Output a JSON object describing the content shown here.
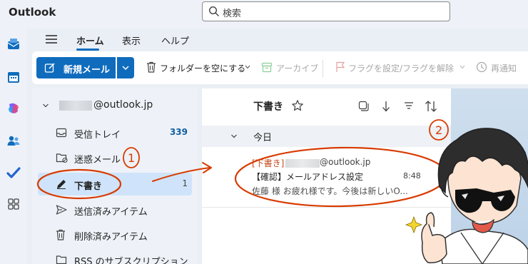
{
  "app": {
    "title": "Outlook"
  },
  "search": {
    "placeholder": "検索"
  },
  "ribbon": {
    "tabs": [
      "ホーム",
      "表示",
      "ヘルプ"
    ],
    "active_tab": "ホーム"
  },
  "toolbar": {
    "new_mail": "新規メール",
    "empty_folder": "フォルダーを空にする",
    "archive": "アーカイブ",
    "flag": "フラグを設定/フラグを解除",
    "snooze": "再通知"
  },
  "account": {
    "label": "@outlook.jp"
  },
  "folders": [
    {
      "name": "受信トレイ",
      "count": "339",
      "icon": "inbox-icon"
    },
    {
      "name": "迷惑メール",
      "count": "",
      "icon": "junk-icon"
    },
    {
      "name": "下書き",
      "count": "1",
      "icon": "pencil-icon"
    },
    {
      "name": "送信済みアイテム",
      "count": "",
      "icon": "send-icon"
    },
    {
      "name": "削除済みアイテム",
      "count": "",
      "icon": "trash-icon"
    },
    {
      "name": "RSS のサブスクリプション",
      "count": "",
      "icon": "folder-icon"
    }
  ],
  "mail_list": {
    "title": "下書き",
    "group": "今日",
    "items": [
      {
        "tag": "[下書き]",
        "sender_domain": "@outlook.jp",
        "subject": "【確認】メールアドレス設定",
        "time": "8:48",
        "preview": "佐藤 様 お疲れ様です。今後は新しいO..."
      }
    ]
  },
  "annotations": {
    "one": "1",
    "two": "2"
  },
  "colors": {
    "accent": "#0f6cbd",
    "selected_bg": "#cfe4fa",
    "draft_tag": "#c4471d",
    "annotation": "#d83b01"
  }
}
